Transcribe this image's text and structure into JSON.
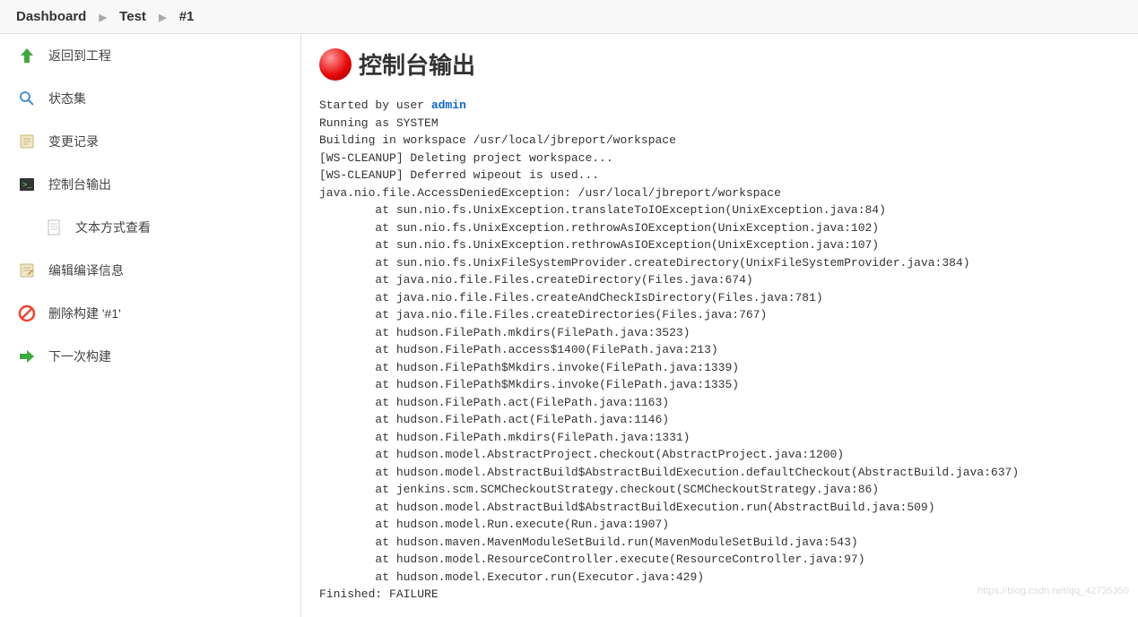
{
  "breadcrumb": {
    "items": [
      "Dashboard",
      "Test",
      "#1"
    ]
  },
  "sidebar": {
    "items": [
      {
        "label": "返回到工程"
      },
      {
        "label": "状态集"
      },
      {
        "label": "变更记录"
      },
      {
        "label": "控制台输出"
      },
      {
        "label": "文本方式查看"
      },
      {
        "label": "编辑编译信息"
      },
      {
        "label": "删除构建 '#1'"
      },
      {
        "label": "下一次构建"
      }
    ]
  },
  "page": {
    "title": "控制台输出"
  },
  "console": {
    "started_by_prefix": "Started by user ",
    "started_by_user": "admin",
    "lines": [
      {
        "t": "Running as SYSTEM"
      },
      {
        "t": "Building in workspace /usr/local/jbreport/workspace"
      },
      {
        "t": "[WS-CLEANUP] Deleting project workspace..."
      },
      {
        "t": "[WS-CLEANUP] Deferred wipeout is used..."
      },
      {
        "t": "java.nio.file.AccessDeniedException: /usr/local/jbreport/workspace"
      },
      {
        "t": "\tat sun.nio.fs.UnixException.translateToIOException(UnixException.java:84)"
      },
      {
        "t": "\tat sun.nio.fs.UnixException.rethrowAsIOException(UnixException.java:102)"
      },
      {
        "t": "\tat sun.nio.fs.UnixException.rethrowAsIOException(UnixException.java:107)"
      },
      {
        "t": "\tat sun.nio.fs.UnixFileSystemProvider.createDirectory(UnixFileSystemProvider.java:384)"
      },
      {
        "t": "\tat java.nio.file.Files.createDirectory(Files.java:674)"
      },
      {
        "t": "\tat java.nio.file.Files.createAndCheckIsDirectory(Files.java:781)"
      },
      {
        "t": "\tat java.nio.file.Files.createDirectories(Files.java:767)"
      },
      {
        "t": "\tat hudson.FilePath.mkdirs(FilePath.java:3523)"
      },
      {
        "t": "\tat hudson.FilePath.access$1400(FilePath.java:213)"
      },
      {
        "t": "\tat hudson.FilePath$Mkdirs.invoke(FilePath.java:1339)"
      },
      {
        "t": "\tat hudson.FilePath$Mkdirs.invoke(FilePath.java:1335)"
      },
      {
        "t": "\tat hudson.FilePath.act(FilePath.java:1163)"
      },
      {
        "t": "\tat hudson.FilePath.act(FilePath.java:1146)"
      },
      {
        "t": "\tat hudson.FilePath.mkdirs(FilePath.java:1331)"
      },
      {
        "t": "\tat hudson.model.AbstractProject.checkout(AbstractProject.java:1200)"
      },
      {
        "t": "\tat hudson.model.AbstractBuild$AbstractBuildExecution.defaultCheckout(AbstractBuild.java:637)"
      },
      {
        "t": "\tat jenkins.scm.SCMCheckoutStrategy.checkout(SCMCheckoutStrategy.java:86)"
      },
      {
        "t": "\tat hudson.model.AbstractBuild$AbstractBuildExecution.run(AbstractBuild.java:509)"
      },
      {
        "t": "\tat hudson.model.Run.execute(Run.java:1907)"
      },
      {
        "t": "\tat hudson.maven.MavenModuleSetBuild.run(MavenModuleSetBuild.java:543)"
      },
      {
        "t": "\tat hudson.model.ResourceController.execute(ResourceController.java:97)"
      },
      {
        "t": "\tat hudson.model.Executor.run(Executor.java:429)"
      },
      {
        "t": "Finished: FAILURE"
      }
    ]
  },
  "watermark": "https://blog.csdn.net/qq_42735350"
}
